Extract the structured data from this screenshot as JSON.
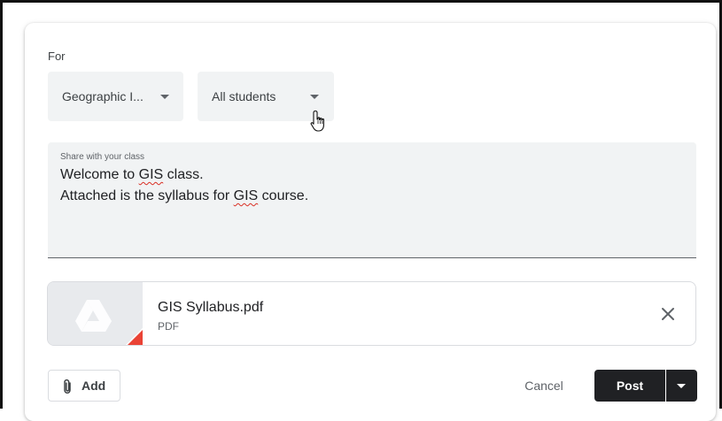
{
  "audience": {
    "for_label": "For",
    "class_select": {
      "value": "Geographic I..."
    },
    "students_select": {
      "value": "All students"
    }
  },
  "composer": {
    "floating_label": "Share with your class",
    "line1_before": "Welcome to ",
    "line1_spell": "GIS",
    "line1_after": " class.",
    "line2_before": "Attached is the syllabus for ",
    "line2_spell": "GIS",
    "line2_after": " course."
  },
  "attachment": {
    "name": "GIS Syllabus.pdf",
    "type": "PDF",
    "thumbnail_icon": "google-drive-icon",
    "pdf_accent_color": "#ea4335"
  },
  "actions": {
    "add_label": "Add",
    "cancel_label": "Cancel",
    "post_label": "Post"
  },
  "colors": {
    "post_button_bg": "#202124",
    "field_bg": "#f1f3f4",
    "spellcheck_underline": "#d93025"
  }
}
